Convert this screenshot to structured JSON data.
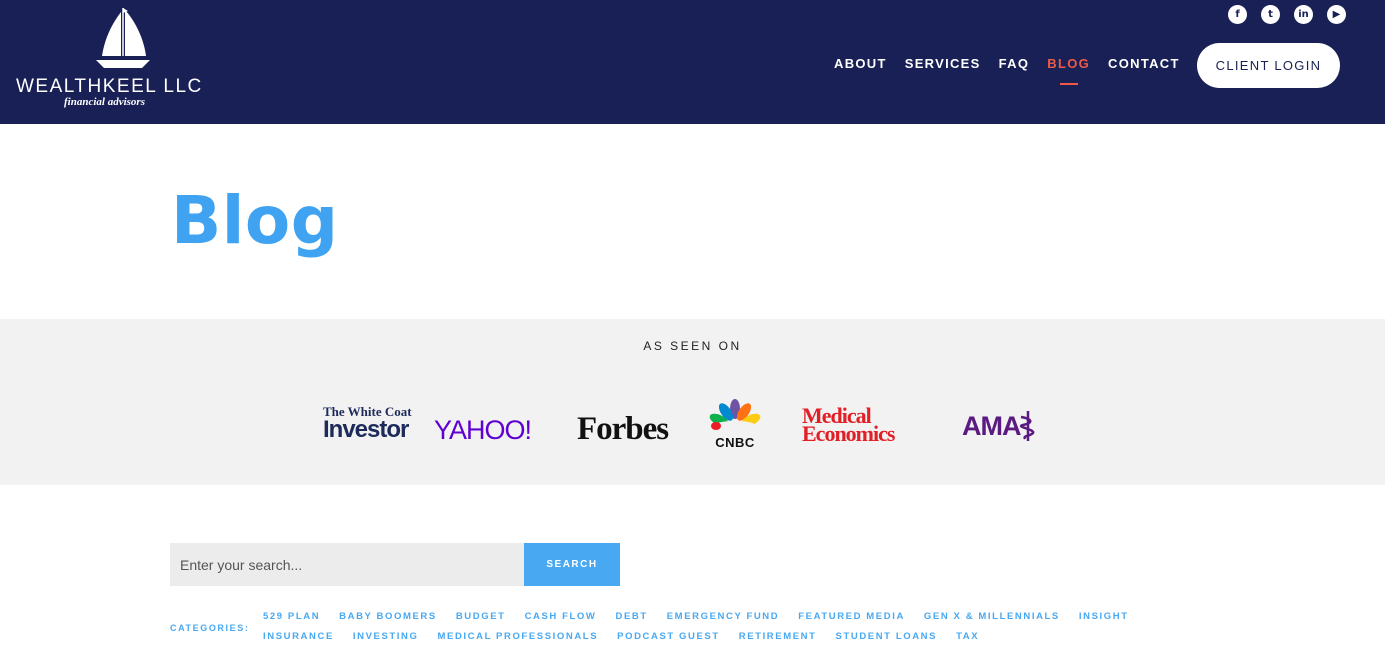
{
  "brand": {
    "name": "WEALTHKEEL LLC",
    "tagline": "financial advisors"
  },
  "social": [
    {
      "icon": "facebook-icon",
      "glyph": "f"
    },
    {
      "icon": "twitter-icon",
      "glyph": "t"
    },
    {
      "icon": "linkedin-icon",
      "glyph": "in"
    },
    {
      "icon": "youtube-icon",
      "glyph": "▶"
    }
  ],
  "nav": {
    "items": [
      "ABOUT",
      "SERVICES",
      "FAQ",
      "BLOG",
      "CONTACT"
    ],
    "active": "BLOG",
    "login_label": "CLIENT LOGIN"
  },
  "page": {
    "title": "Blog"
  },
  "seen_on": {
    "label": "AS SEEN ON",
    "logos": {
      "wci_small": "The White Coat",
      "wci_big": "Investor",
      "yahoo": "YAHOO!",
      "forbes": "Forbes",
      "cnbc": "CNBC",
      "medical_1": "Medical",
      "medical_2": "Economics",
      "ama": "AMA"
    }
  },
  "search": {
    "placeholder": "Enter your search...",
    "button_label": "SEARCH"
  },
  "categories": {
    "label": "CATEGORIES:",
    "row1": [
      "529 PLAN",
      "BABY BOOMERS",
      "BUDGET",
      "CASH FLOW",
      "DEBT",
      "EMERGENCY FUND",
      "FEATURED MEDIA",
      "GEN X & MILLENNIALS",
      "INSIGHT"
    ],
    "row2": [
      "INSURANCE",
      "INVESTING",
      "MEDICAL PROFESSIONALS",
      "PODCAST GUEST",
      "RETIREMENT",
      "STUDENT LOANS",
      "TAX"
    ]
  },
  "colors": {
    "navy": "#182055",
    "accent": "#ee5a47",
    "blue": "#3fa3f1"
  }
}
